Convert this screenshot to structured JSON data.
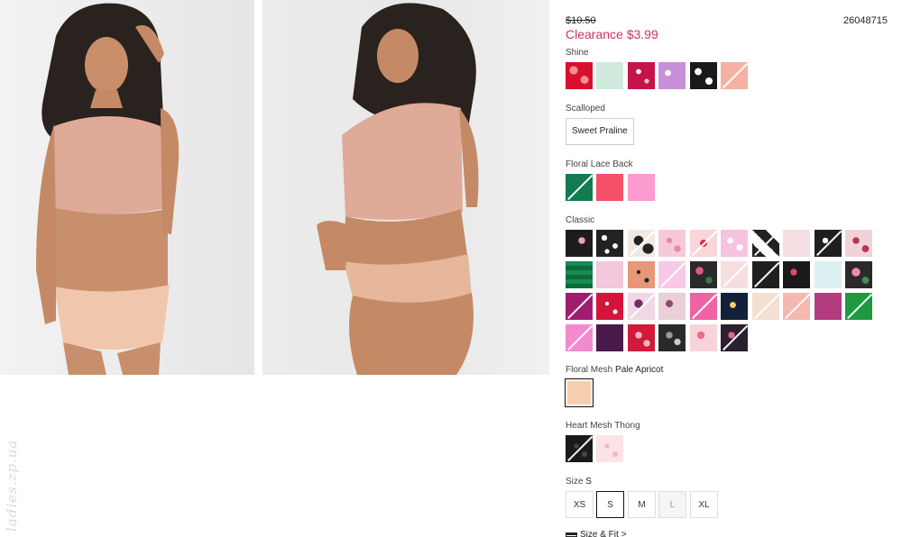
{
  "product": {
    "price_original": "$10.50",
    "price_clearance": "Clearance $3.99",
    "sku": "26048715"
  },
  "groups": {
    "shine": {
      "label": "Shine"
    },
    "scalloped": {
      "label": "Scalloped",
      "option": "Sweet Praline"
    },
    "floral_lace_back": {
      "label": "Floral Lace Back"
    },
    "classic": {
      "label": "Classic"
    },
    "floral_mesh": {
      "label": "Floral Mesh",
      "selected_value": "Pale Apricot"
    },
    "heart_mesh_thong": {
      "label": "Heart Mesh Thong"
    }
  },
  "size": {
    "label": "Size",
    "selected_value": "S",
    "options": [
      "XS",
      "S",
      "M",
      "L",
      "XL"
    ],
    "fit_link": "Size & Fit",
    "fit_chevron": ">"
  },
  "watermark": "ladies.zp.ua",
  "colors": {
    "accent": "#d0306a",
    "selected_border": "#111111"
  },
  "icons": {
    "size_fit": "ruler-icon"
  }
}
